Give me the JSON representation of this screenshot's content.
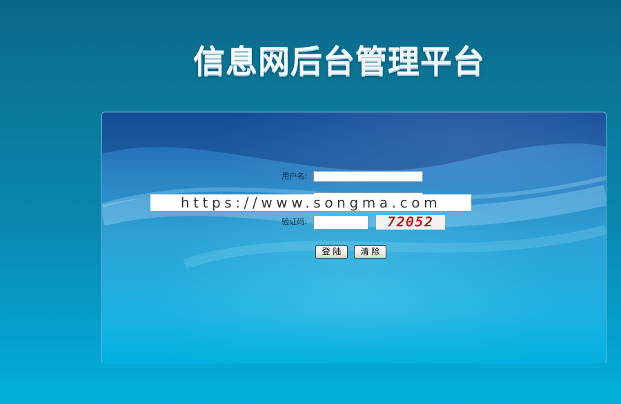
{
  "header": {
    "title": "信息网后台管理平台"
  },
  "form": {
    "username_label": "用户名:",
    "username_value": "",
    "password_value": "",
    "captcha_label": "验证码:",
    "captcha_value": "",
    "captcha_image_text": "72052",
    "login_button": "登 陆",
    "clear_button": "清 除"
  },
  "watermark": {
    "text": "https://www.songma.com"
  },
  "colors": {
    "background_top": "#0b6789",
    "background_bottom": "#03b0dd",
    "panel_top": "#1a5fa8",
    "captcha_text": "#e2141a"
  }
}
